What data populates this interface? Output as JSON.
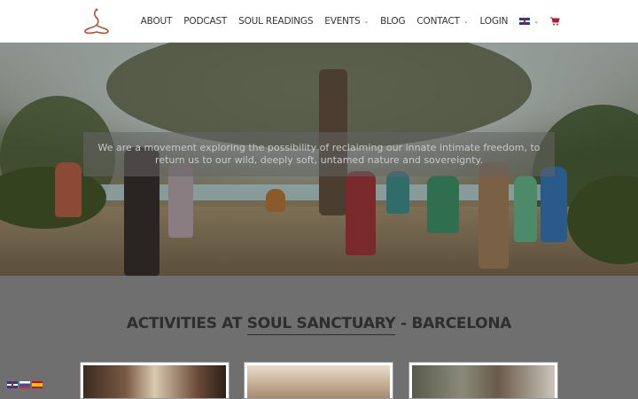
{
  "nav": {
    "items": [
      {
        "label": "ABOUT",
        "dropdown": false
      },
      {
        "label": "PODCAST",
        "dropdown": false
      },
      {
        "label": "SOUL READINGS",
        "dropdown": false
      },
      {
        "label": "EVENTS",
        "dropdown": true
      },
      {
        "label": "BLOG",
        "dropdown": false
      },
      {
        "label": "CONTACT",
        "dropdown": true
      },
      {
        "label": "LOGIN",
        "dropdown": false
      }
    ],
    "language_icon": "uk-flag-icon",
    "cart_icon": "cart-icon"
  },
  "hero": {
    "text": "We are a movement exploring the possibility of reclaiming our innate intimate freedom, to return us to our wild, deeply soft, untamed nature and sovereignty."
  },
  "activities": {
    "title_prefix": "ACTIVITIES AT",
    "title_highlight": "SOUL SANCTUARY",
    "title_suffix": "- BARCELONA"
  },
  "language_switcher": [
    "uk-flag-icon",
    "russia-flag-icon",
    "spain-flag-icon"
  ],
  "colors": {
    "logo": "#b3502f",
    "overlay": "#6f6f6f",
    "header_bg": "#ffffff",
    "cart": "#b01e2c"
  }
}
